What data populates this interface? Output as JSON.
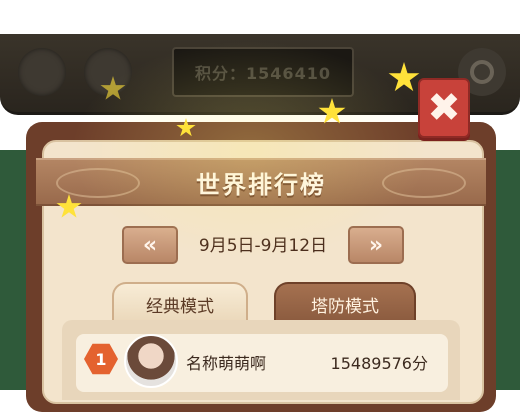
{
  "top_bar": {
    "score_label": "积分：1546410"
  },
  "dialog": {
    "title": "世界排行榜",
    "date_range": "9月5日-9月12日",
    "prev_arrow": "«",
    "next_arrow": "»",
    "close_symbol": "✖"
  },
  "tabs": [
    {
      "label": "经典模式",
      "active": true
    },
    {
      "label": "塔防模式",
      "active": false
    }
  ],
  "leaderboard": [
    {
      "rank": "1",
      "name": "名称萌萌啊",
      "score": "15489576分"
    }
  ],
  "colors": {
    "accent": "#c8423a",
    "panel": "#f3e4cc",
    "frame": "#6d3e2a",
    "star": "#ffe23a"
  }
}
